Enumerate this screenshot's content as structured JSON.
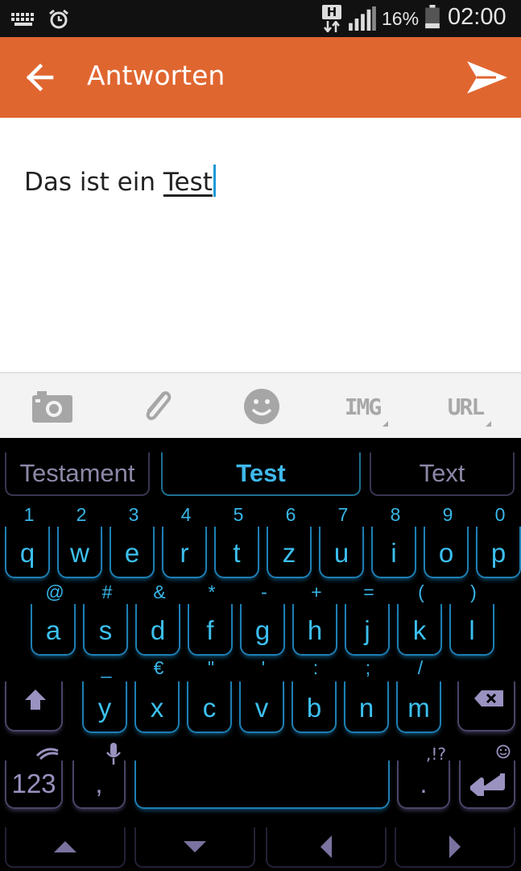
{
  "status_bar": {
    "battery_percent": "16%",
    "time": "02:00",
    "network_type": "H",
    "icons": [
      "keyboard-icon",
      "alarm-icon",
      "network-h-icon",
      "signal-icon",
      "battery-icon"
    ]
  },
  "app_bar": {
    "title": "Antworten",
    "color": "#e06630",
    "back_icon": "arrow-left-icon",
    "send_icon": "send-icon"
  },
  "compose": {
    "text_before": "Das ist ein ",
    "composing_word": "Test"
  },
  "attach_bar": {
    "camera_icon": "camera-icon",
    "attach_icon": "paperclip-icon",
    "emoji_icon": "smiley-icon",
    "img_label": "IMG",
    "url_label": "URL"
  },
  "keyboard": {
    "suggestions": [
      "Testament",
      "Test",
      "Text"
    ],
    "row1_keys": [
      "q",
      "w",
      "e",
      "r",
      "t",
      "z",
      "u",
      "i",
      "o",
      "p"
    ],
    "row1_alts": [
      "1",
      "2",
      "3",
      "4",
      "5",
      "6",
      "7",
      "8",
      "9",
      "0"
    ],
    "row2_keys": [
      "a",
      "s",
      "d",
      "f",
      "g",
      "h",
      "j",
      "k",
      "l"
    ],
    "row2_alts": [
      "@",
      "#",
      "&",
      "*",
      "-",
      "+",
      "=",
      "(",
      ")"
    ],
    "row3_keys": [
      "y",
      "x",
      "c",
      "v",
      "b",
      "n",
      "m"
    ],
    "row3_alts": [
      "_",
      "€",
      "\"",
      "'",
      ":",
      ";",
      "/"
    ],
    "numbers_key": "123",
    "comma_key": ",",
    "period_key": ".",
    "period_alt": ",!?",
    "accent_color": "#3cc0ef"
  }
}
